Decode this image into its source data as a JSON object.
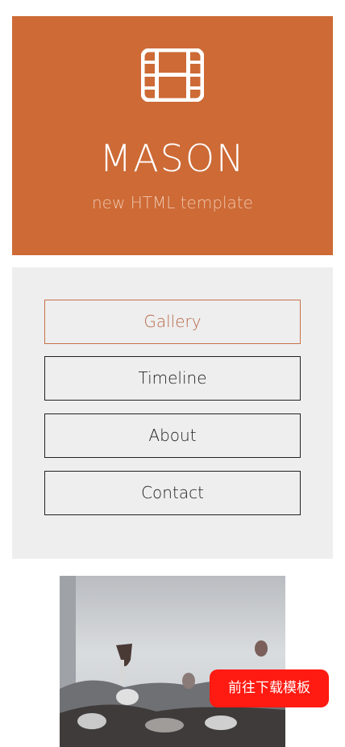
{
  "header": {
    "icon": "film-icon",
    "title": "MASON",
    "subtitle": "new HTML template",
    "background_color": "#cd6a36"
  },
  "nav": {
    "items": [
      {
        "label": "Gallery",
        "active": true
      },
      {
        "label": "Timeline",
        "active": false
      },
      {
        "label": "About",
        "active": false
      },
      {
        "label": "Contact",
        "active": false
      }
    ],
    "active_color": "#c8714b"
  },
  "gallery": {
    "image": "party-photo"
  },
  "download_button": {
    "label": "前往下载模板",
    "color": "#ff1a12"
  }
}
